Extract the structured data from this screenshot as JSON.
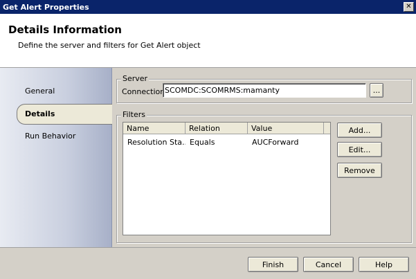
{
  "window": {
    "title": "Get Alert Properties",
    "close_glyph": "✕"
  },
  "header": {
    "title": "Details Information",
    "subtitle": "Define the server and filters for Get Alert object"
  },
  "sidebar": {
    "items": [
      {
        "label": "General"
      },
      {
        "label": "Details"
      },
      {
        "label": "Run Behavior"
      }
    ],
    "selected": "Details"
  },
  "server": {
    "group_label": "Server",
    "connection_label": "Connection",
    "connection_value": "SCOMDC:SCOMRMS:mamanty",
    "browse_label": "..."
  },
  "filters": {
    "group_label": "Filters",
    "columns": [
      "Name",
      "Relation",
      "Value"
    ],
    "rows": [
      {
        "name": "Resolution Sta...",
        "relation": "Equals",
        "value": "AUCForward"
      }
    ],
    "add_label": "Add...",
    "edit_label": "Edit...",
    "remove_label": "Remove"
  },
  "footer": {
    "finish_label": "Finish",
    "cancel_label": "Cancel",
    "help_label": "Help"
  }
}
